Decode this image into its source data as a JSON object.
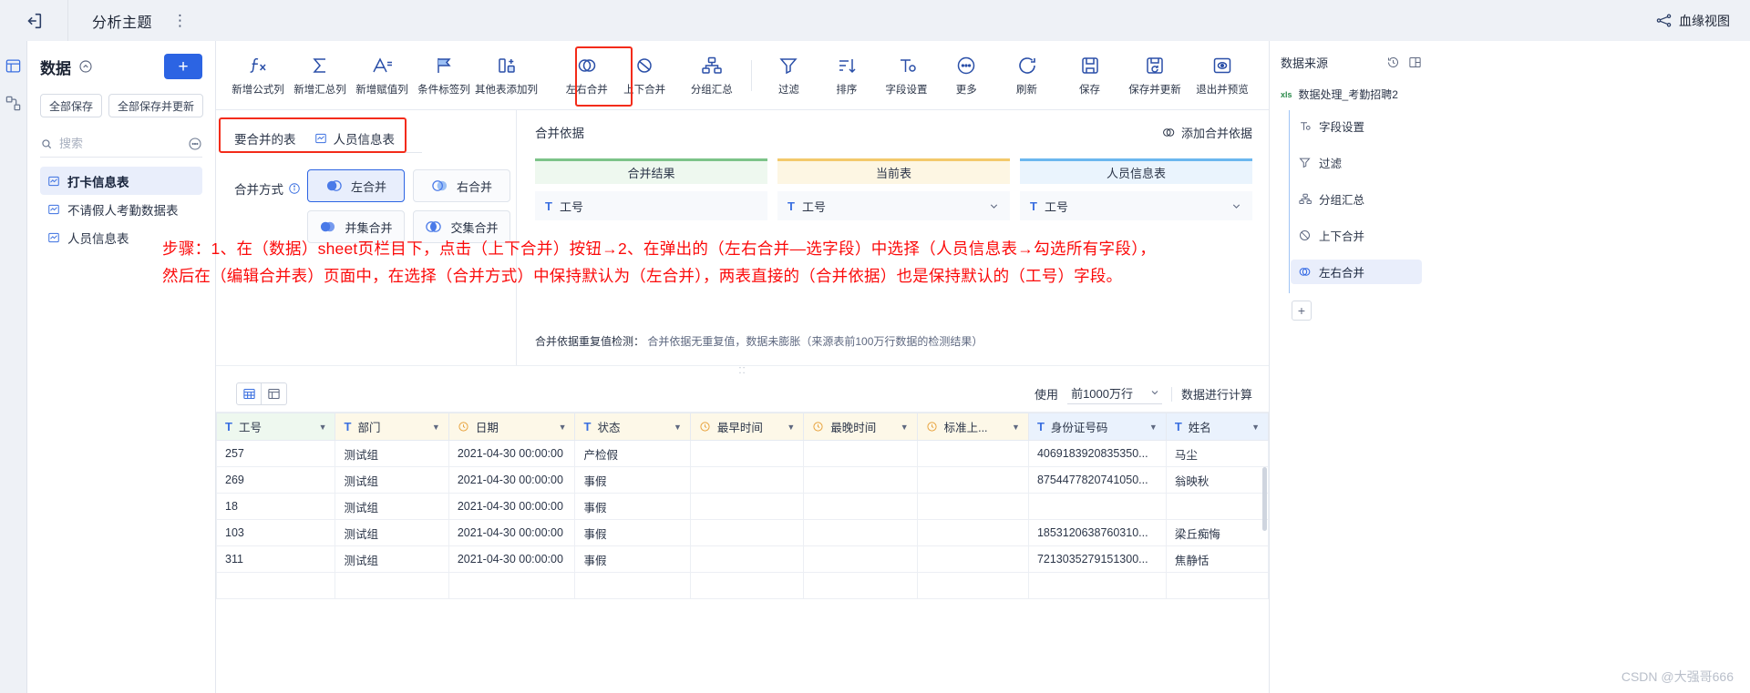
{
  "topbar": {
    "back_icon": "back-arrow-icon",
    "title": "分析主题",
    "more": "⋮",
    "lineage_label": "血缘视图"
  },
  "left_panel": {
    "title": "数据",
    "add_button": "+",
    "buttons": [
      "全部保存",
      "全部保存并更新"
    ],
    "search_placeholder": "搜索",
    "items": [
      {
        "label": "打卡信息表",
        "active": true
      },
      {
        "label": "不请假人考勤数据表",
        "active": false
      },
      {
        "label": "人员信息表",
        "active": false
      }
    ]
  },
  "toolbar": {
    "items": [
      {
        "label": "新增公式列",
        "icon": "fx-icon"
      },
      {
        "label": "新增汇总列",
        "icon": "sigma-icon"
      },
      {
        "label": "新增赋值列",
        "icon": "assign-column-icon"
      },
      {
        "label": "条件标签列",
        "icon": "flag-icon"
      },
      {
        "label": "其他表添加列",
        "icon": "add-column-icon"
      },
      {
        "label": "左右合并",
        "icon": "horizontal-merge-icon",
        "highlighted": true
      },
      {
        "label": "上下合并",
        "icon": "vertical-merge-icon"
      },
      {
        "label": "分组汇总",
        "icon": "group-summary-icon"
      },
      {
        "label": "过滤",
        "icon": "filter-icon"
      },
      {
        "label": "排序",
        "icon": "sort-icon"
      },
      {
        "label": "字段设置",
        "icon": "field-settings-icon"
      },
      {
        "label": "更多",
        "icon": "more-icon"
      }
    ],
    "right_items": [
      {
        "label": "刷新",
        "icon": "refresh-icon"
      },
      {
        "label": "保存",
        "icon": "save-icon"
      },
      {
        "label": "保存并更新",
        "icon": "save-update-icon"
      },
      {
        "label": "退出并预览",
        "icon": "exit-preview-icon"
      }
    ]
  },
  "merge_config": {
    "table_row_label": "要合并的表",
    "table_row_value": "人员信息表",
    "mode_label": "合并方式",
    "modes": [
      {
        "label": "左合并",
        "selected": true
      },
      {
        "label": "右合并",
        "selected": false
      },
      {
        "label": "并集合并",
        "selected": false
      },
      {
        "label": "交集合并",
        "selected": false
      }
    ],
    "basis_title": "合并依据",
    "add_basis": "添加合并依据",
    "columns": [
      {
        "header": "合并结果",
        "field": "工号",
        "has_chevron": false,
        "tone": "green"
      },
      {
        "header": "当前表",
        "field": "工号",
        "has_chevron": true,
        "tone": "amber"
      },
      {
        "header": "人员信息表",
        "field": "工号",
        "has_chevron": true,
        "tone": "blue"
      }
    ],
    "dup_check_label": "合并依据重复值检测：",
    "dup_check_value": "合并依据无重复值，数据未膨胀（来源表前100万行数据的检测结果）"
  },
  "annotation": "步骤：1、在（数据）sheet页栏目下，点击（上下合并）按钮→2、在弹出的（左右合并—选字段）中选择（人员信息表→勾选所有字段），然后在（编辑合并表）页面中，在选择（合并方式）中保持默认为（左合并），两表直接的（合并依据）也是保持默认的（工号）字段。",
  "preview": {
    "use_label": "使用",
    "rows_value": "前1000万行",
    "calc_label": "数据进行计算",
    "columns": [
      {
        "name": "工号",
        "type": "text",
        "tone": "green"
      },
      {
        "name": "部门",
        "type": "text",
        "tone": "amber"
      },
      {
        "name": "日期",
        "type": "time",
        "tone": "amber"
      },
      {
        "name": "状态",
        "type": "text",
        "tone": "amber"
      },
      {
        "name": "最早时间",
        "type": "time",
        "tone": "amber"
      },
      {
        "name": "最晚时间",
        "type": "time",
        "tone": "amber"
      },
      {
        "name": "标准上...",
        "type": "time",
        "tone": "amber"
      },
      {
        "name": "身份证号码",
        "type": "text",
        "tone": "blue"
      },
      {
        "name": "姓名",
        "type": "text",
        "tone": "blue"
      }
    ],
    "rows": [
      [
        "257",
        "测试组",
        "2021-04-30 00:00:00",
        "产检假",
        "",
        "",
        "",
        "4069183920835350...",
        "马尘"
      ],
      [
        "269",
        "测试组",
        "2021-04-30 00:00:00",
        "事假",
        "",
        "",
        "",
        "8754477820741050...",
        "翁映秋"
      ],
      [
        "18",
        "测试组",
        "2021-04-30 00:00:00",
        "事假",
        "",
        "",
        "",
        "",
        ""
      ],
      [
        "103",
        "测试组",
        "2021-04-30 00:00:00",
        "事假",
        "",
        "",
        "",
        "1853120638760310...",
        "梁丘痴悔"
      ],
      [
        "311",
        "测试组",
        "2021-04-30 00:00:00",
        "事假",
        "",
        "",
        "",
        "7213035279151300...",
        "焦静恬"
      ],
      [
        "",
        "",
        "",
        "",
        "",
        "",
        "",
        "",
        ""
      ]
    ]
  },
  "right_panel": {
    "title": "数据来源",
    "source_badge": "xls",
    "source_name": "数据处理_考勤招聘2",
    "nodes": [
      {
        "label": "字段设置",
        "icon": "field-settings-icon",
        "active": false
      },
      {
        "label": "过滤",
        "icon": "filter-icon",
        "active": false
      },
      {
        "label": "分组汇总",
        "icon": "group-summary-icon",
        "active": false
      },
      {
        "label": "上下合并",
        "icon": "vertical-merge-icon",
        "active": false
      },
      {
        "label": "左右合并",
        "icon": "horizontal-merge-icon",
        "active": true
      }
    ],
    "add_node": "+"
  },
  "watermark": "CSDN @大强哥666"
}
